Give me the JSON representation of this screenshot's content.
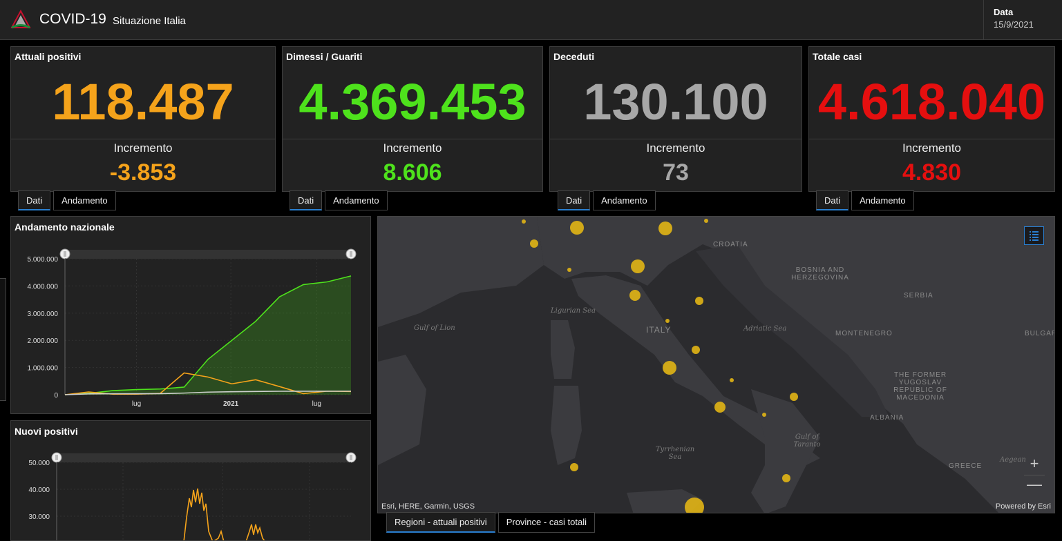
{
  "header": {
    "title": "COVID-19",
    "subtitle": "Situazione Italia",
    "date_label": "Data",
    "date_value": "15/9/2021"
  },
  "cards": [
    {
      "title": "Attuali positivi",
      "value": "118.487",
      "inc_label": "Incremento",
      "inc_value": "-3.853",
      "color": "#f5a31b"
    },
    {
      "title": "Dimessi / Guariti",
      "value": "4.369.453",
      "inc_label": "Incremento",
      "inc_value": "8.606",
      "color": "#4ee21c"
    },
    {
      "title": "Deceduti",
      "value": "130.100",
      "inc_label": "Incremento",
      "inc_value": "73",
      "color": "#a7a7a7"
    },
    {
      "title": "Totale casi",
      "value": "4.618.040",
      "inc_label": "Incremento",
      "inc_value": "4.830",
      "color": "#e50f0f"
    }
  ],
  "card_tabs": {
    "tab1": "Dati",
    "tab2": "Andamento"
  },
  "chart1_title": "Andamento nazionale",
  "chart2_title": "Nuovi positivi",
  "chart_data": [
    {
      "type": "area",
      "title": "Andamento nazionale",
      "y_ticks": [
        "5.000.000",
        "4.000.000",
        "3.000.000",
        "2.000.000",
        "1.000.000",
        "0"
      ],
      "x_ticks": [
        "lug",
        "2021",
        "lug"
      ],
      "ylim": [
        0,
        5000000
      ],
      "grid": true,
      "series": [
        {
          "color": "#4ee21c",
          "values": [
            0,
            50000,
            150000,
            190000,
            210000,
            280000,
            1300000,
            2000000,
            2700000,
            3600000,
            4050000,
            4150000,
            4369453
          ]
        },
        {
          "color": "#f5a31b",
          "values": [
            0,
            100000,
            20000,
            20000,
            50000,
            800000,
            650000,
            400000,
            550000,
            300000,
            40000,
            130000,
            118487
          ]
        },
        {
          "color": "#cfcfcf",
          "values": [
            0,
            30000,
            35000,
            36000,
            38000,
            60000,
            95000,
            110000,
            120000,
            127000,
            128000,
            129500,
            130100
          ]
        }
      ]
    },
    {
      "type": "line",
      "title": "Nuovi positivi",
      "y_ticks": [
        "50.000",
        "40.000",
        "30.000"
      ],
      "ylim": [
        0,
        50000
      ],
      "grid": true,
      "series": [
        {
          "color": "#f5a31b",
          "values": []
        }
      ]
    }
  ],
  "map": {
    "attribution": "Esri, HERE, Garmin, USGS",
    "powered": "Powered by Esri",
    "zoom_in": "+",
    "zoom_out": "—",
    "labels": {
      "croatia": "CROATIA",
      "bosnia": "BOSNIA AND HERZEGOVINA",
      "serbia": "SERBIA",
      "italy": "ITALY",
      "montenegro": "MONTENEGRO",
      "bulgaria": "BULGAR",
      "macedonia": "THE FORMER YUGOSLAV REPUBLIC OF MACEDONIA",
      "albania": "ALBANIA",
      "greece": "GREECE",
      "ligurian": "Ligurian Sea",
      "lion": "Gulf of Lion",
      "adriatic": "Adriatic Sea",
      "tyrrhenian": "Tyrrhenian Sea",
      "taranto": "Gulf of Taranto",
      "aegean": "Aegean"
    }
  },
  "map_tabs": {
    "regions": "Regioni - attuali positivi",
    "provinces": "Province - casi totali"
  }
}
